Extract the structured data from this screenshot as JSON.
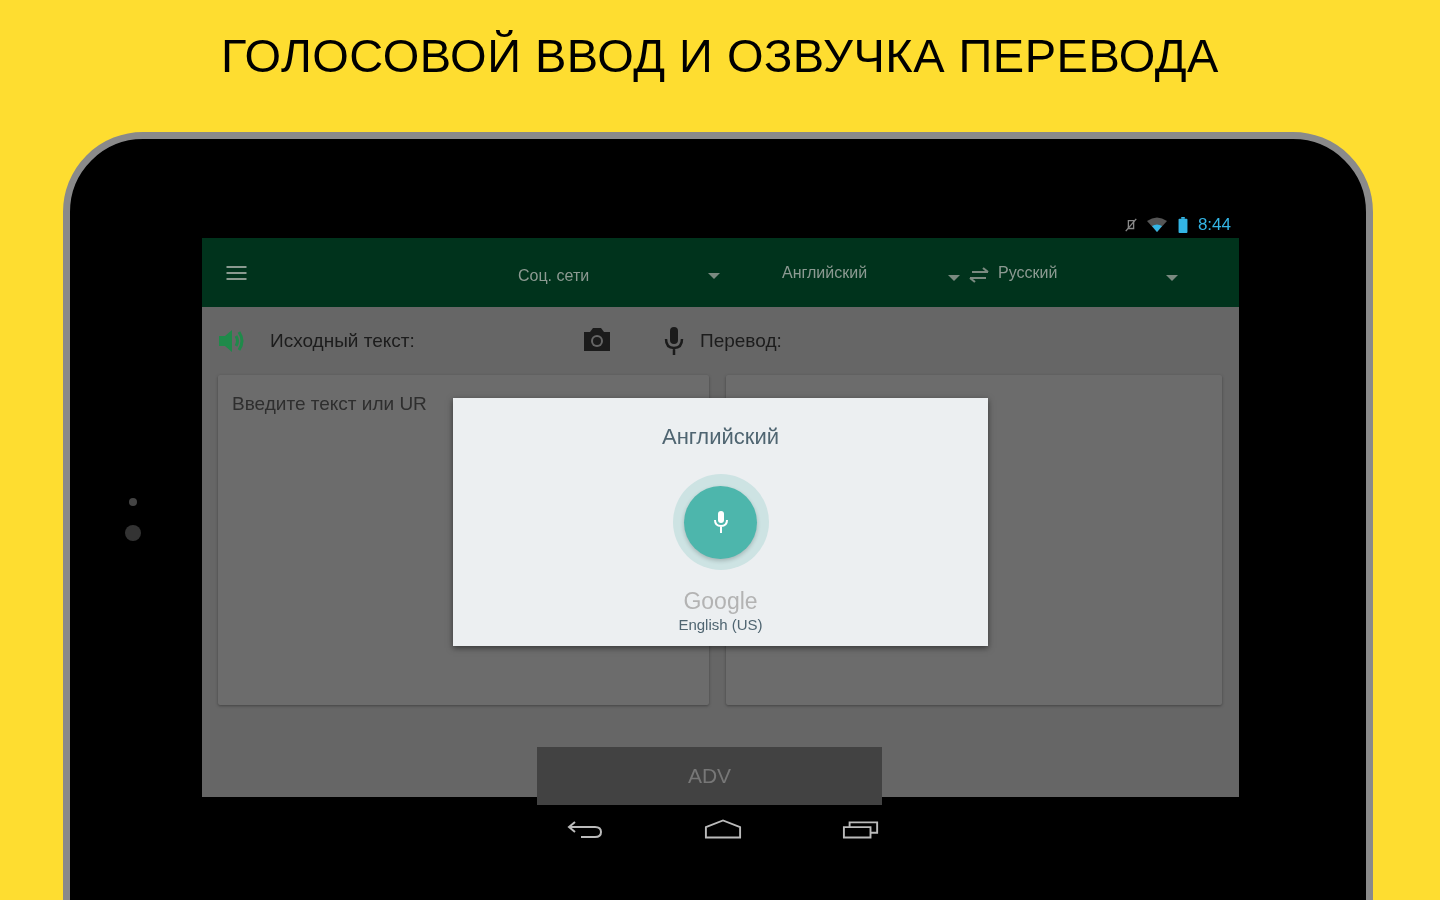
{
  "headline": "ГОЛОСОВОЙ ВВОД И ОЗВУЧКА ПЕРЕВОДА",
  "status_bar": {
    "time": "8:44"
  },
  "toolbar": {
    "category": "Соц. сети",
    "source_language": "Английский",
    "target_language": "Русский"
  },
  "source": {
    "label": "Исходный текст:",
    "placeholder": "Введите текст или UR"
  },
  "translation": {
    "label": "Перевод:"
  },
  "voice_dialog": {
    "title": "Английский",
    "provider": "Google",
    "locale": "English (US)"
  },
  "ad": {
    "label": "ADV"
  }
}
